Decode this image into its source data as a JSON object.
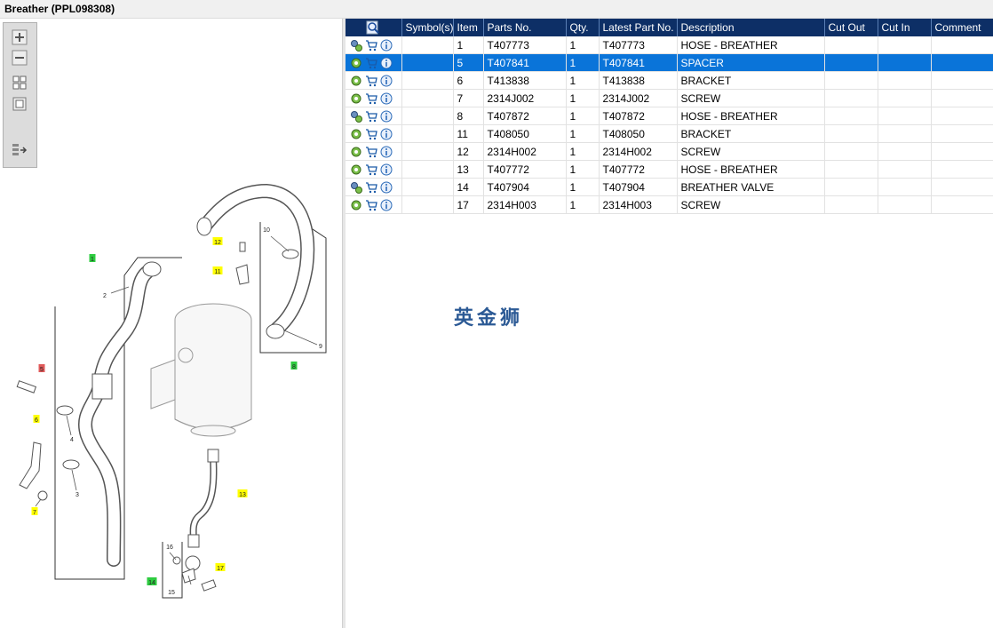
{
  "window": {
    "title": "Breather (PPL098308)"
  },
  "toolbar": {
    "zoom_in": "zoom-in",
    "zoom_out": "zoom-out",
    "fit": "fit-all",
    "actual": "actual-size",
    "export": "export-list"
  },
  "diagram": {
    "callouts": [
      {
        "label": "1",
        "color": "#2ecc40"
      },
      {
        "label": "2",
        "color": ""
      },
      {
        "label": "3",
        "color": ""
      },
      {
        "label": "4",
        "color": ""
      },
      {
        "label": "5",
        "color": "#e05a5a"
      },
      {
        "label": "6",
        "color": "#ffff00"
      },
      {
        "label": "7",
        "color": "#ffff00"
      },
      {
        "label": "8",
        "color": "#2ecc40"
      },
      {
        "label": "9",
        "color": ""
      },
      {
        "label": "10",
        "color": ""
      },
      {
        "label": "11",
        "color": "#ffff00"
      },
      {
        "label": "12",
        "color": "#ffff00"
      },
      {
        "label": "13",
        "color": "#ffff00"
      },
      {
        "label": "14",
        "color": "#2ecc40"
      },
      {
        "label": "15",
        "color": ""
      },
      {
        "label": "16",
        "color": ""
      },
      {
        "label": "17",
        "color": "#ffff00"
      }
    ]
  },
  "grid": {
    "headers": [
      "",
      "Symbol(s)",
      "Item",
      "Parts No.",
      "Qty.",
      "Latest Part No.",
      "Description",
      "Cut Out",
      "Cut In",
      "Comment"
    ],
    "rows": [
      {
        "icons": [
          "gears-icon",
          "cart-icon",
          "info-icon"
        ],
        "symbols": "",
        "item": "1",
        "part": "T407773",
        "qty": "1",
        "latest": "T407773",
        "desc": "HOSE - BREATHER",
        "cut_out": "",
        "cut_in": "",
        "comment": "",
        "selected": false
      },
      {
        "icons": [
          "gear-icon",
          "cart-icon",
          "info-icon"
        ],
        "symbols": "",
        "item": "5",
        "part": "T407841",
        "qty": "1",
        "latest": "T407841",
        "desc": "SPACER",
        "cut_out": "",
        "cut_in": "",
        "comment": "",
        "selected": true
      },
      {
        "icons": [
          "gear-icon",
          "cart-icon",
          "info-icon"
        ],
        "symbols": "",
        "item": "6",
        "part": "T413838",
        "qty": "1",
        "latest": "T413838",
        "desc": "BRACKET",
        "cut_out": "",
        "cut_in": "",
        "comment": "",
        "selected": false
      },
      {
        "icons": [
          "gear-icon",
          "cart-icon",
          "info-icon"
        ],
        "symbols": "",
        "item": "7",
        "part": "2314J002",
        "qty": "1",
        "latest": "2314J002",
        "desc": "SCREW",
        "cut_out": "",
        "cut_in": "",
        "comment": "",
        "selected": false
      },
      {
        "icons": [
          "gears-icon",
          "cart-icon",
          "info-icon"
        ],
        "symbols": "",
        "item": "8",
        "part": "T407872",
        "qty": "1",
        "latest": "T407872",
        "desc": "HOSE - BREATHER",
        "cut_out": "",
        "cut_in": "",
        "comment": "",
        "selected": false
      },
      {
        "icons": [
          "gear-icon",
          "cart-icon",
          "info-icon"
        ],
        "symbols": "",
        "item": "11",
        "part": "T408050",
        "qty": "1",
        "latest": "T408050",
        "desc": "BRACKET",
        "cut_out": "",
        "cut_in": "",
        "comment": "",
        "selected": false
      },
      {
        "icons": [
          "gear-icon",
          "cart-icon",
          "info-icon"
        ],
        "symbols": "",
        "item": "12",
        "part": "2314H002",
        "qty": "1",
        "latest": "2314H002",
        "desc": "SCREW",
        "cut_out": "",
        "cut_in": "",
        "comment": "",
        "selected": false
      },
      {
        "icons": [
          "gear-icon",
          "cart-icon",
          "info-icon"
        ],
        "symbols": "",
        "item": "13",
        "part": "T407772",
        "qty": "1",
        "latest": "T407772",
        "desc": "HOSE - BREATHER",
        "cut_out": "",
        "cut_in": "",
        "comment": "",
        "selected": false
      },
      {
        "icons": [
          "gears-icon",
          "cart-icon",
          "info-icon"
        ],
        "symbols": "",
        "item": "14",
        "part": "T407904",
        "qty": "1",
        "latest": "T407904",
        "desc": "BREATHER VALVE",
        "cut_out": "",
        "cut_in": "",
        "comment": "",
        "selected": false
      },
      {
        "icons": [
          "gear-icon",
          "cart-icon",
          "info-icon"
        ],
        "symbols": "",
        "item": "17",
        "part": "2314H003",
        "qty": "1",
        "latest": "2314H003",
        "desc": "SCREW",
        "cut_out": "",
        "cut_in": "",
        "comment": "",
        "selected": false
      }
    ]
  },
  "watermark": {
    "text": "英金狮"
  },
  "colors": {
    "header_bg": "#0d2f66",
    "selected_row": "#0a74d9",
    "highlight_green": "#2ecc40",
    "highlight_yellow": "#ffff00",
    "highlight_red": "#e05a5a"
  }
}
